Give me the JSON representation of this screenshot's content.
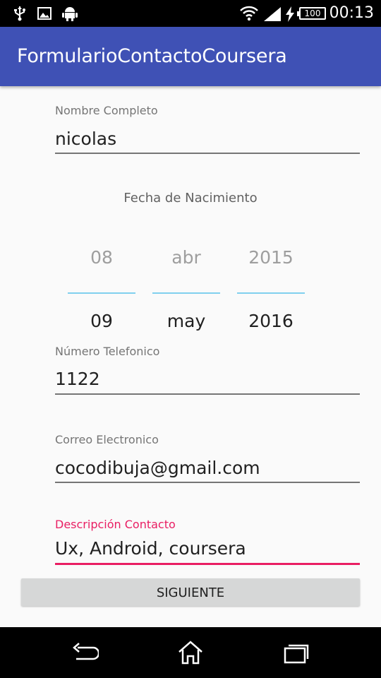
{
  "status_bar": {
    "time": "00:13",
    "battery": "100",
    "icons": [
      "usb-icon",
      "image-icon",
      "android-icon",
      "wifi-icon",
      "signal-icon",
      "charging-icon"
    ]
  },
  "app_bar": {
    "title": "FormularioContactoCoursera",
    "color": "#3f51b5"
  },
  "form": {
    "name": {
      "label": "Nombre Completo",
      "value": "nicolas"
    },
    "birth_date": {
      "heading": "Fecha de Nacimiento",
      "day": {
        "previous": "08",
        "selected": "09"
      },
      "month": {
        "previous": "abr",
        "selected": "may"
      },
      "year": {
        "previous": "2015",
        "selected": "2016"
      }
    },
    "phone": {
      "label": "Número Telefonico",
      "value": "1122"
    },
    "email": {
      "label": "Correo Electronico",
      "value": "cocodibuja@gmail.com"
    },
    "description": {
      "label": "Descripción Contacto",
      "value": "Ux, Android, coursera",
      "accent": "#e91e63"
    }
  },
  "next_button": {
    "label": "SIGUIENTE"
  },
  "nav_bar": {
    "icons": [
      "back-icon",
      "home-icon",
      "recents-icon"
    ]
  }
}
